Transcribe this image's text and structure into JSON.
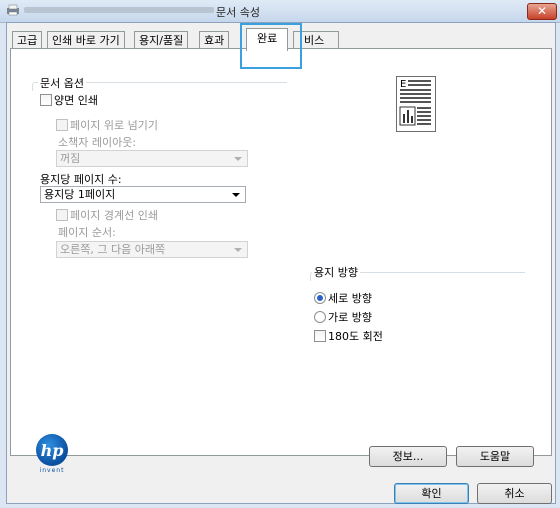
{
  "window": {
    "title": "문서 속성",
    "close_label": "✕"
  },
  "tabs": [
    {
      "label": "고급"
    },
    {
      "label": "인쇄 바로 가기"
    },
    {
      "label": "용지/품질"
    },
    {
      "label": "효과"
    },
    {
      "label": "완료"
    },
    {
      "label": "비스"
    }
  ],
  "document_options": {
    "legend": "문서 옵션",
    "duplex_label": "양면 인쇄",
    "flip_pages_up_label": "페이지 위로 넘기기",
    "booklet_layout_label": "소책자 레이아웃:",
    "booklet_layout_value": "꺼짐",
    "pages_per_sheet_label": "용지당 페이지 수:",
    "pages_per_sheet_value": "용지당 1페이지",
    "print_page_borders_label": "페이지 경계선 인쇄",
    "page_order_label": "페이지 순서:",
    "page_order_value": "오른쪽, 그 다음 아래쪽"
  },
  "orientation": {
    "legend": "용지 방향",
    "portrait_label": "세로 방향",
    "landscape_label": "가로 방향",
    "rotate_label": "180도 회전",
    "selected": "portrait"
  },
  "buttons": {
    "about": "정보...",
    "help": "도움말",
    "ok": "확인",
    "cancel": "취소"
  },
  "logo": {
    "brand_text": "hp",
    "tagline": "invent"
  },
  "colors": {
    "highlight": "#3aa0e0",
    "radio_selected": "#2a62c9",
    "hp_blue": "#0a4e9f"
  }
}
